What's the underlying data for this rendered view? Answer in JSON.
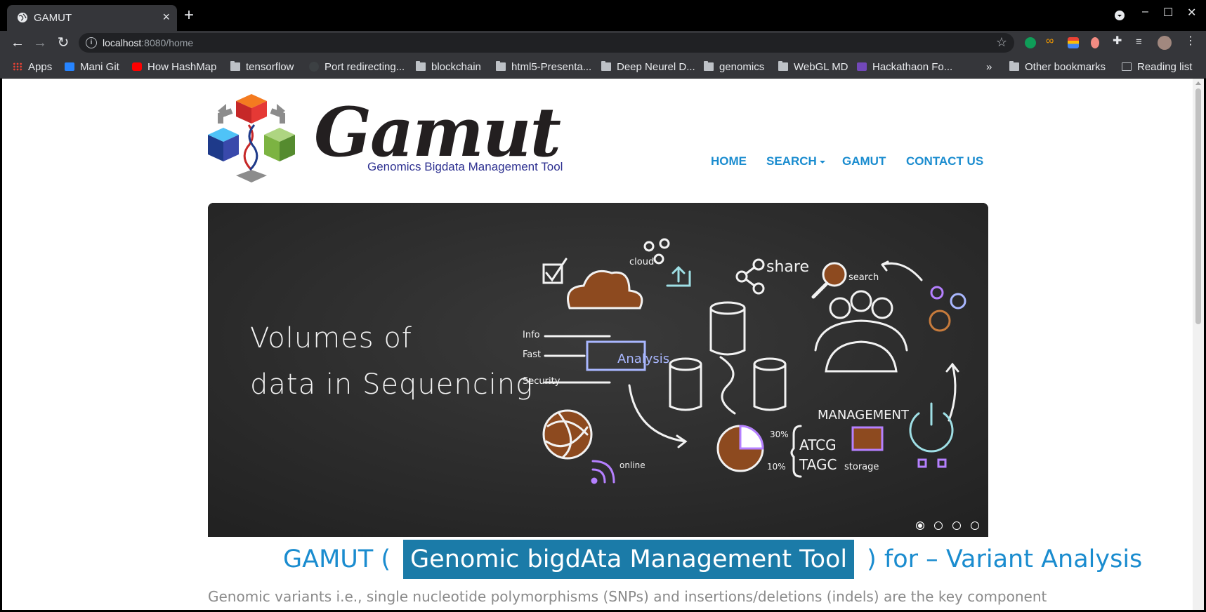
{
  "browser": {
    "tab_title": "GAMUT",
    "url_host": "localhost",
    "url_path": ":8080/home",
    "bookmarks": [
      {
        "label": "Apps",
        "icon": "apps-grid-icon"
      },
      {
        "label": "Mani Git",
        "icon": "bitbucket-icon"
      },
      {
        "label": "How HashMap",
        "icon": "youtube-icon"
      },
      {
        "label": "tensorflow",
        "icon": "folder-icon"
      },
      {
        "label": "Port redirecting...",
        "icon": "globe-icon"
      },
      {
        "label": "blockchain",
        "icon": "folder-icon"
      },
      {
        "label": "html5-Presenta...",
        "icon": "folder-icon"
      },
      {
        "label": "Deep Neurel D...",
        "icon": "folder-icon"
      },
      {
        "label": "genomics",
        "icon": "folder-icon"
      },
      {
        "label": "WebGL MD",
        "icon": "folder-icon"
      },
      {
        "label": "Hackathaon Fo...",
        "icon": "forms-icon"
      }
    ],
    "overflow_label": "»",
    "other_bookmarks": "Other bookmarks",
    "reading_list": "Reading list"
  },
  "site": {
    "logo_word": "Gamut",
    "logo_subtitle": "Genomics Bigdata Management Tool",
    "nav": {
      "home": "HOME",
      "search": "SEARCH",
      "gamut": "GAMUT",
      "contact": "CONTACT US"
    },
    "carousel": {
      "line1": "Volumes   of",
      "line2": "data   in   Sequencing",
      "slide_count": 4,
      "active_slide": 1
    },
    "headline": {
      "prefix": "GAMUT (",
      "boxed": "Genomic bigdAta Management Tool",
      "suffix": ") for – Variant Analysis"
    },
    "intro": "Genomic variants i.e., single nucleotide polymorphisms (SNPs) and insertions/deletions (indels) are the key component"
  },
  "colors": {
    "accent": "#1a8ccf",
    "headline_box": "#1b7ba8",
    "chalkboard": "#2e2e2e"
  }
}
